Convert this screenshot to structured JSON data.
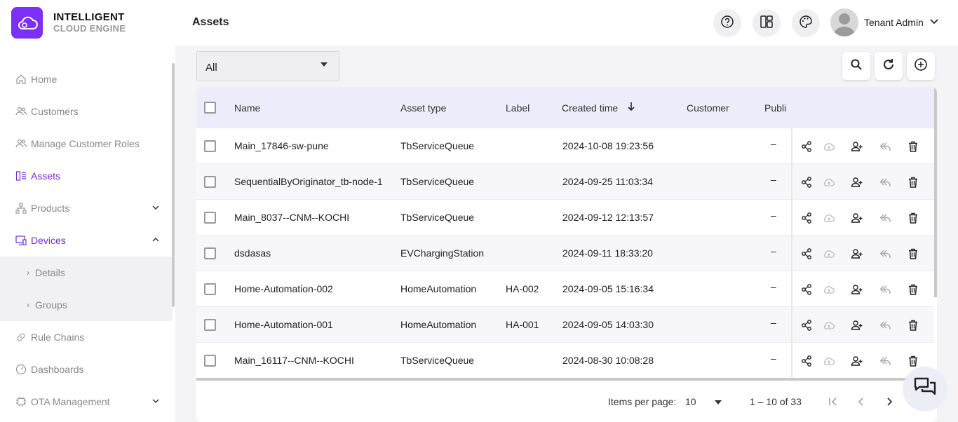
{
  "brand": {
    "line1": "INTELLIGENT",
    "line2": "CLOUD ENGINE",
    "accent": "#7b2ff7"
  },
  "header": {
    "title": "Assets",
    "user_name": "Tenant Admin"
  },
  "sidebar": {
    "items": [
      {
        "label": "Home",
        "icon": "home-icon"
      },
      {
        "label": "Customers",
        "icon": "users-icon"
      },
      {
        "label": "Manage Customer Roles",
        "icon": "users-icon"
      },
      {
        "label": "Assets",
        "icon": "assets-icon",
        "active": true
      },
      {
        "label": "Products",
        "icon": "hierarchy-icon",
        "expandable": true
      },
      {
        "label": "Devices",
        "icon": "devices-icon",
        "active": true,
        "expanded": true
      },
      {
        "label": "Details",
        "sub": true
      },
      {
        "label": "Groups",
        "sub": true
      },
      {
        "label": "Rule Chains",
        "icon": "link-icon"
      },
      {
        "label": "Dashboards",
        "icon": "dashboard-icon"
      },
      {
        "label": "OTA Management",
        "icon": "chip-icon",
        "expandable": true
      }
    ]
  },
  "filter": {
    "value": "All"
  },
  "table": {
    "columns": [
      "Name",
      "Asset type",
      "Label",
      "Created time",
      "Customer",
      "Publi"
    ],
    "rows": [
      {
        "name": "Main_17846-sw-pune",
        "type": "TbServiceQueue",
        "label": "",
        "created": "2024-10-08 19:23:56",
        "customer": "",
        "public": "–"
      },
      {
        "name": "SequentialByOriginator_tb-node-1",
        "type": "TbServiceQueue",
        "label": "",
        "created": "2024-09-25 11:03:34",
        "customer": "",
        "public": "–"
      },
      {
        "name": "Main_8037--CNM--KOCHI",
        "type": "TbServiceQueue",
        "label": "",
        "created": "2024-09-12 12:13:57",
        "customer": "",
        "public": "–"
      },
      {
        "name": "dsdasas",
        "type": "EVChargingStation",
        "label": "",
        "created": "2024-09-11 18:33:20",
        "customer": "",
        "public": "–"
      },
      {
        "name": "Home-Automation-002",
        "type": "HomeAutomation",
        "label": "HA-002",
        "created": "2024-09-05 15:16:34",
        "customer": "",
        "public": "–"
      },
      {
        "name": "Home-Automation-001",
        "type": "HomeAutomation",
        "label": "HA-001",
        "created": "2024-09-05 14:03:30",
        "customer": "",
        "public": "–"
      },
      {
        "name": "Main_16117--CNM--KOCHI",
        "type": "TbServiceQueue",
        "label": "",
        "created": "2024-08-30 10:08:28",
        "customer": "",
        "public": "–"
      }
    ]
  },
  "paginator": {
    "items_per_page_label": "Items per page:",
    "page_size": "10",
    "range": "1 – 10 of 33"
  }
}
